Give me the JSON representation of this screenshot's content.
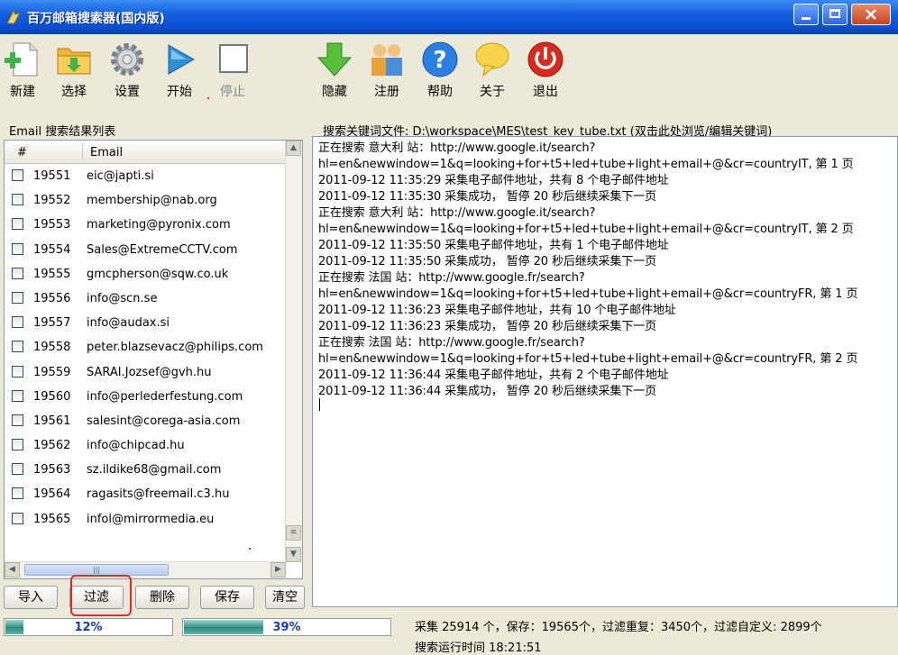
{
  "window": {
    "title": "百万邮箱搜索器(国内版)"
  },
  "toolbar": {
    "new": "新建",
    "select": "选择",
    "settings": "设置",
    "start": "开始",
    "stop": "停止",
    "hide": "隐藏",
    "register": "注册",
    "help": "帮助",
    "about": "关于",
    "exit": "退出"
  },
  "left": {
    "caption": "Email 搜索结果列表",
    "col_num": "#",
    "col_email": "Email",
    "rows": [
      {
        "num": "19551",
        "email": "eic@japti.si"
      },
      {
        "num": "19552",
        "email": "membership@nab.org"
      },
      {
        "num": "19553",
        "email": "marketing@pyronix.com"
      },
      {
        "num": "19554",
        "email": "Sales@ExtremeCCTV.com"
      },
      {
        "num": "19555",
        "email": "gmcpherson@sqw.co.uk"
      },
      {
        "num": "19556",
        "email": "info@scn.se"
      },
      {
        "num": "19557",
        "email": "info@audax.si"
      },
      {
        "num": "19558",
        "email": "peter.blazsevacz@philips.com"
      },
      {
        "num": "19559",
        "email": "SARAI.Jozsef@gvh.hu"
      },
      {
        "num": "19560",
        "email": "info@perlederfestung.com"
      },
      {
        "num": "19561",
        "email": "salesint@corega-asia.com"
      },
      {
        "num": "19562",
        "email": "info@chipcad.hu"
      },
      {
        "num": "19563",
        "email": "sz.ildike68@gmail.com"
      },
      {
        "num": "19564",
        "email": "ragasits@freemail.c3.hu"
      },
      {
        "num": "19565",
        "email": "infol@mirrormedia.eu"
      }
    ]
  },
  "buttons": {
    "import": "导入",
    "filter": "过滤",
    "delete": "删除",
    "save": "保存",
    "clear": "清空"
  },
  "right": {
    "keyword_file": "搜索关键词文件: D:\\workspace\\MES\\test_key_tube.txt (双击此处浏览/编辑关键词)",
    "log": [
      "正在搜索 意大利 站：http://www.google.it/search?",
      "hl=en&newwindow=1&q=looking+for+t5+led+tube+light+email+@&cr=countryIT, 第 1 页",
      "2011-09-12 11:35:29 采集电子邮件地址，共有 8 个电子邮件地址",
      "2011-09-12 11:35:30 采集成功， 暂停 20 秒后继续采集下一页",
      "正在搜索 意大利 站：http://www.google.it/search?",
      "hl=en&newwindow=1&q=looking+for+t5+led+tube+light+email+@&cr=countryIT, 第 2 页",
      "2011-09-12 11:35:50 采集电子邮件地址，共有 1 个电子邮件地址",
      "2011-09-12 11:35:50 采集成功， 暂停 20 秒后继续采集下一页",
      "正在搜索 法国 站：http://www.google.fr/search?",
      "hl=en&newwindow=1&q=looking+for+t5+led+tube+light+email+@&cr=countryFR, 第 1 页",
      "2011-09-12 11:36:23 采集电子邮件地址，共有 10 个电子邮件地址",
      "2011-09-12 11:36:23 采集成功， 暂停 20 秒后继续采集下一页",
      "正在搜索 法国 站：http://www.google.fr/search?",
      "hl=en&newwindow=1&q=looking+for+t5+led+tube+light+email+@&cr=countryFR, 第 2 页",
      "2011-09-12 11:36:44 采集电子邮件地址，共有 2 个电子邮件地址",
      "2011-09-12 11:36:44 采集成功， 暂停 20 秒后继续采集下一页"
    ]
  },
  "status": {
    "progress1": 0.12,
    "progress1_label": "12%",
    "progress2": 0.39,
    "progress2_label": "39%",
    "summary": "采集 25914 个，保存：19565个，过滤重复：3450个，过滤自定义: 2899个",
    "elapsed_partial": "搜索运行时间 18:21:51"
  },
  "colors": {
    "title_bar": "#0a4fd0",
    "progress": "#2f8a80",
    "highlight": "#e8252a"
  }
}
